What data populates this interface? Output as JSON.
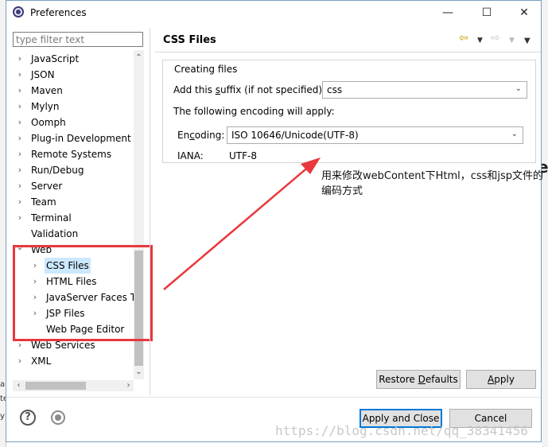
{
  "window": {
    "title": "Preferences",
    "minimize_glyph": "—",
    "maximize_glyph": "☐",
    "close_glyph": "✕"
  },
  "sidebar": {
    "filter_placeholder": "type filter text",
    "items": [
      {
        "label": "JavaScript",
        "chevron": "›"
      },
      {
        "label": "JSON",
        "chevron": "›"
      },
      {
        "label": "Maven",
        "chevron": "›"
      },
      {
        "label": "Mylyn",
        "chevron": "›"
      },
      {
        "label": "Oomph",
        "chevron": "›"
      },
      {
        "label": "Plug-in Development",
        "chevron": "›"
      },
      {
        "label": "Remote Systems",
        "chevron": "›"
      },
      {
        "label": "Run/Debug",
        "chevron": "›"
      },
      {
        "label": "Server",
        "chevron": "›"
      },
      {
        "label": "Team",
        "chevron": "›"
      },
      {
        "label": "Terminal",
        "chevron": "›"
      },
      {
        "label": "Validation",
        "chevron": ""
      },
      {
        "label": "Web",
        "chevron": "⌄"
      },
      {
        "label": "CSS Files",
        "chevron": "›"
      },
      {
        "label": "HTML Files",
        "chevron": "›"
      },
      {
        "label": "JavaServer Faces T",
        "chevron": "›"
      },
      {
        "label": "JSP Files",
        "chevron": "›"
      },
      {
        "label": "Web Page Editor",
        "chevron": ""
      },
      {
        "label": "Web Services",
        "chevron": "›"
      },
      {
        "label": "XML",
        "chevron": "›"
      }
    ]
  },
  "page": {
    "title": "CSS Files",
    "group_label": "Creating files",
    "suffix_label_pre": "Add this ",
    "suffix_label_mnemonic": "s",
    "suffix_label_post": "uffix (if not specified):",
    "suffix_value": "css",
    "encoding_note": "The following encoding will apply:",
    "encoding_label_pre": "En",
    "encoding_label_mnemonic": "c",
    "encoding_label_post": "oding:",
    "encoding_value": "ISO 10646/Unicode(UTF-8)",
    "iana_label": "IANA:",
    "iana_value": "UTF-8"
  },
  "annotation": {
    "text": "用来修改webContent下Html，css和jsp文件的编码方式",
    "color": "#e8383d"
  },
  "buttons": {
    "restore_pre": "Restore ",
    "restore_mnemonic": "D",
    "restore_post": "efaults",
    "apply_mnemonic": "A",
    "apply_post": "pply",
    "apply_close": "Apply and Close",
    "cancel": "Cancel"
  },
  "footer": {
    "help_glyph": "?"
  },
  "watermark": "https://blog.csdn.net/qq_38341456",
  "background_fragments": [
    "e",
    "a",
    "te",
    "y"
  ]
}
